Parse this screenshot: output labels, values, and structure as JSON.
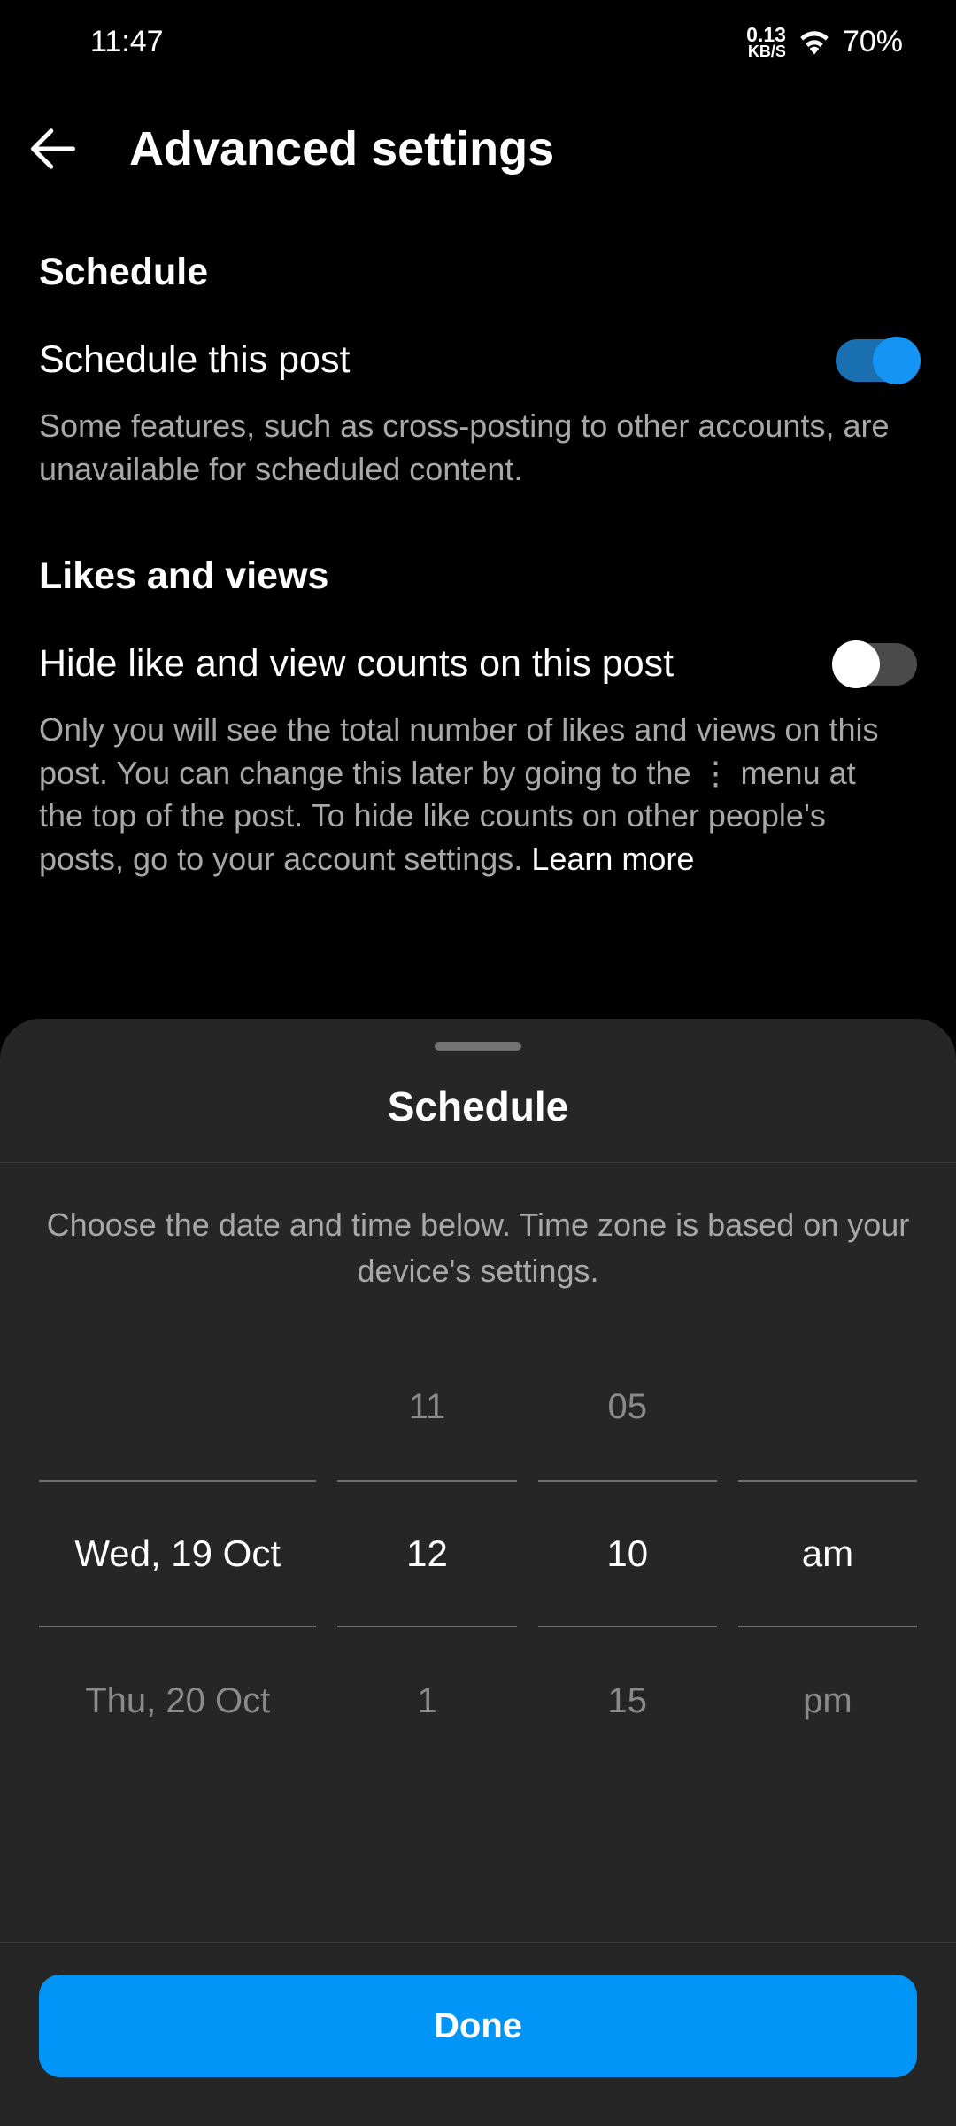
{
  "status": {
    "time": "11:47",
    "net_speed": "0.13",
    "net_unit": "KB/S",
    "battery": "70%"
  },
  "header": {
    "title": "Advanced settings"
  },
  "schedule_section": {
    "title": "Schedule",
    "toggle_label": "Schedule this post",
    "toggle_on": true,
    "description": "Some features, such as cross-posting to other accounts, are unavailable for scheduled content."
  },
  "likes_section": {
    "title": "Likes and views",
    "toggle_label": "Hide like and view counts on this post",
    "toggle_on": false,
    "description": "Only you will see the total number of likes and views on this post. You can change this later by going to the ⋮ menu at the top of the post. To hide like counts on other people's posts, go to your account settings. ",
    "learn_more": "Learn more"
  },
  "sheet": {
    "title": "Schedule",
    "description": "Choose the date and time below. Time zone is based on your device's settings.",
    "picker": {
      "date": {
        "prev": "",
        "selected": "Wed, 19 Oct",
        "next": "Thu, 20 Oct"
      },
      "hour": {
        "prev": "11",
        "selected": "12",
        "next": "1"
      },
      "minute": {
        "prev": "05",
        "selected": "10",
        "next": "15"
      },
      "ampm": {
        "prev": "",
        "selected": "am",
        "next": "pm"
      }
    },
    "done": "Done"
  }
}
